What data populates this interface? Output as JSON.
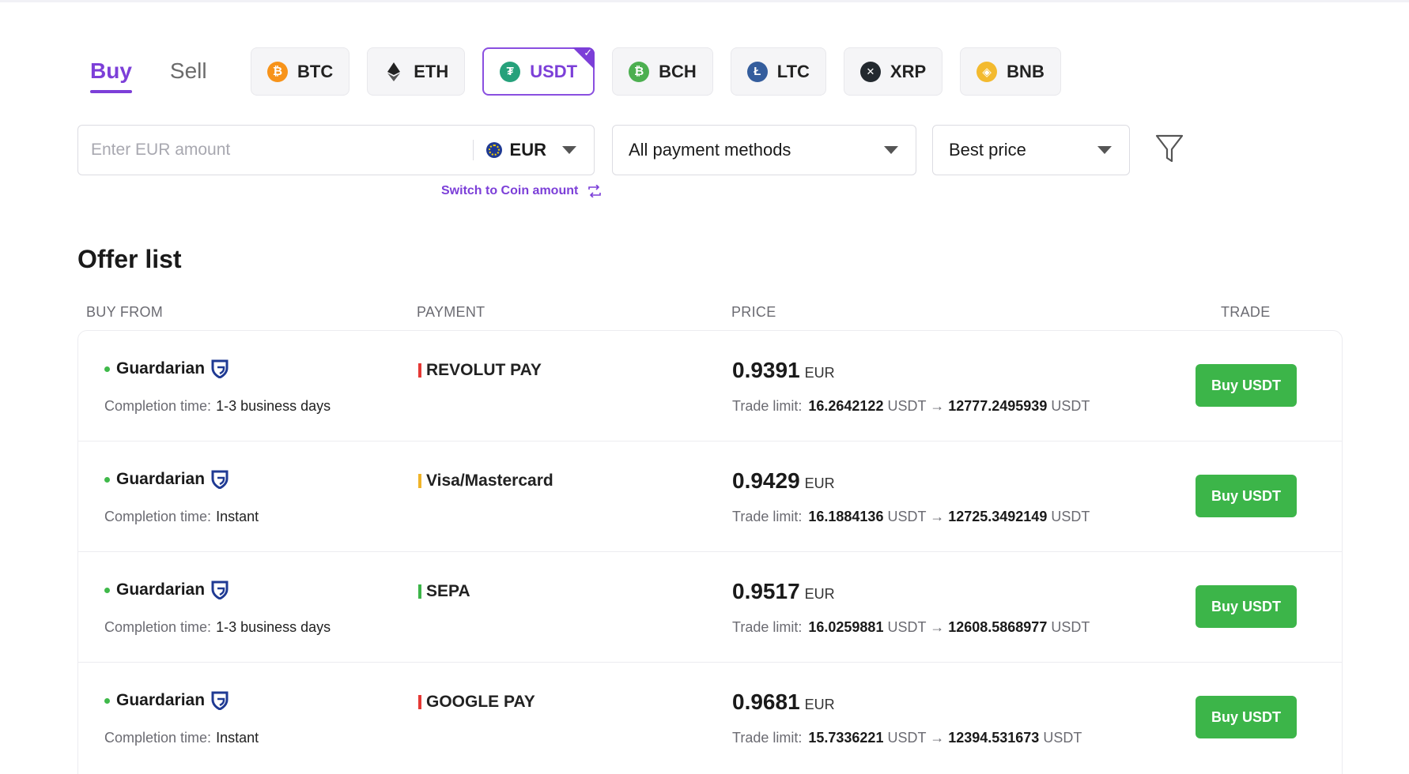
{
  "tabs": [
    {
      "label": "Buy",
      "active": true
    },
    {
      "label": "Sell",
      "active": false
    }
  ],
  "coins": [
    {
      "symbol": "BTC",
      "icon": "bitcoin-icon",
      "glyph": "₿",
      "color": "#f7931a",
      "active": false
    },
    {
      "symbol": "ETH",
      "icon": "ethereum-icon",
      "glyph": "",
      "color": "#222222",
      "active": false
    },
    {
      "symbol": "USDT",
      "icon": "tether-icon",
      "glyph": "₮",
      "color": "#26a17b",
      "active": true
    },
    {
      "symbol": "BCH",
      "icon": "bitcoin-cash-icon",
      "glyph": "₿",
      "color": "#4caf50",
      "active": false
    },
    {
      "symbol": "LTC",
      "icon": "litecoin-icon",
      "glyph": "Ł",
      "color": "#345d9d",
      "active": false
    },
    {
      "symbol": "XRP",
      "icon": "xrp-icon",
      "glyph": "✕",
      "color": "#23292f",
      "active": false
    },
    {
      "symbol": "BNB",
      "icon": "bnb-icon",
      "glyph": "◈",
      "color": "#f3ba2f",
      "active": false
    }
  ],
  "amount": {
    "placeholder": "Enter EUR amount",
    "value": "",
    "currency": "EUR"
  },
  "payment_filter": {
    "selected": "All payment methods"
  },
  "sort": {
    "selected": "Best price"
  },
  "switch_link": "Switch to Coin amount",
  "offer_list": {
    "title": "Offer list",
    "columns": [
      "BUY FROM",
      "PAYMENT",
      "PRICE",
      "TRADE"
    ],
    "completion_label": "Completion time:",
    "limit_label": "Trade limit:",
    "rows": [
      {
        "vendor": "Guardarian",
        "completion": "1-3 business days",
        "payment": "REVOLUT PAY",
        "payment_color": "#e53935",
        "price": "0.9391",
        "price_currency": "EUR",
        "limit_min": "16.2642122",
        "limit_max": "12777.2495939",
        "unit": "USDT",
        "button": "Buy USDT"
      },
      {
        "vendor": "Guardarian",
        "completion": "Instant",
        "payment": "Visa/Mastercard",
        "payment_color": "#f0b429",
        "price": "0.9429",
        "price_currency": "EUR",
        "limit_min": "16.1884136",
        "limit_max": "12725.3492149",
        "unit": "USDT",
        "button": "Buy USDT"
      },
      {
        "vendor": "Guardarian",
        "completion": "1-3 business days",
        "payment": "SEPA",
        "payment_color": "#3cb549",
        "price": "0.9517",
        "price_currency": "EUR",
        "limit_min": "16.0259881",
        "limit_max": "12608.5868977",
        "unit": "USDT",
        "button": "Buy USDT"
      },
      {
        "vendor": "Guardarian",
        "completion": "Instant",
        "payment": "GOOGLE PAY",
        "payment_color": "#e53935",
        "price": "0.9681",
        "price_currency": "EUR",
        "limit_min": "15.7336221",
        "limit_max": "12394.531673",
        "unit": "USDT",
        "button": "Buy USDT"
      }
    ]
  }
}
